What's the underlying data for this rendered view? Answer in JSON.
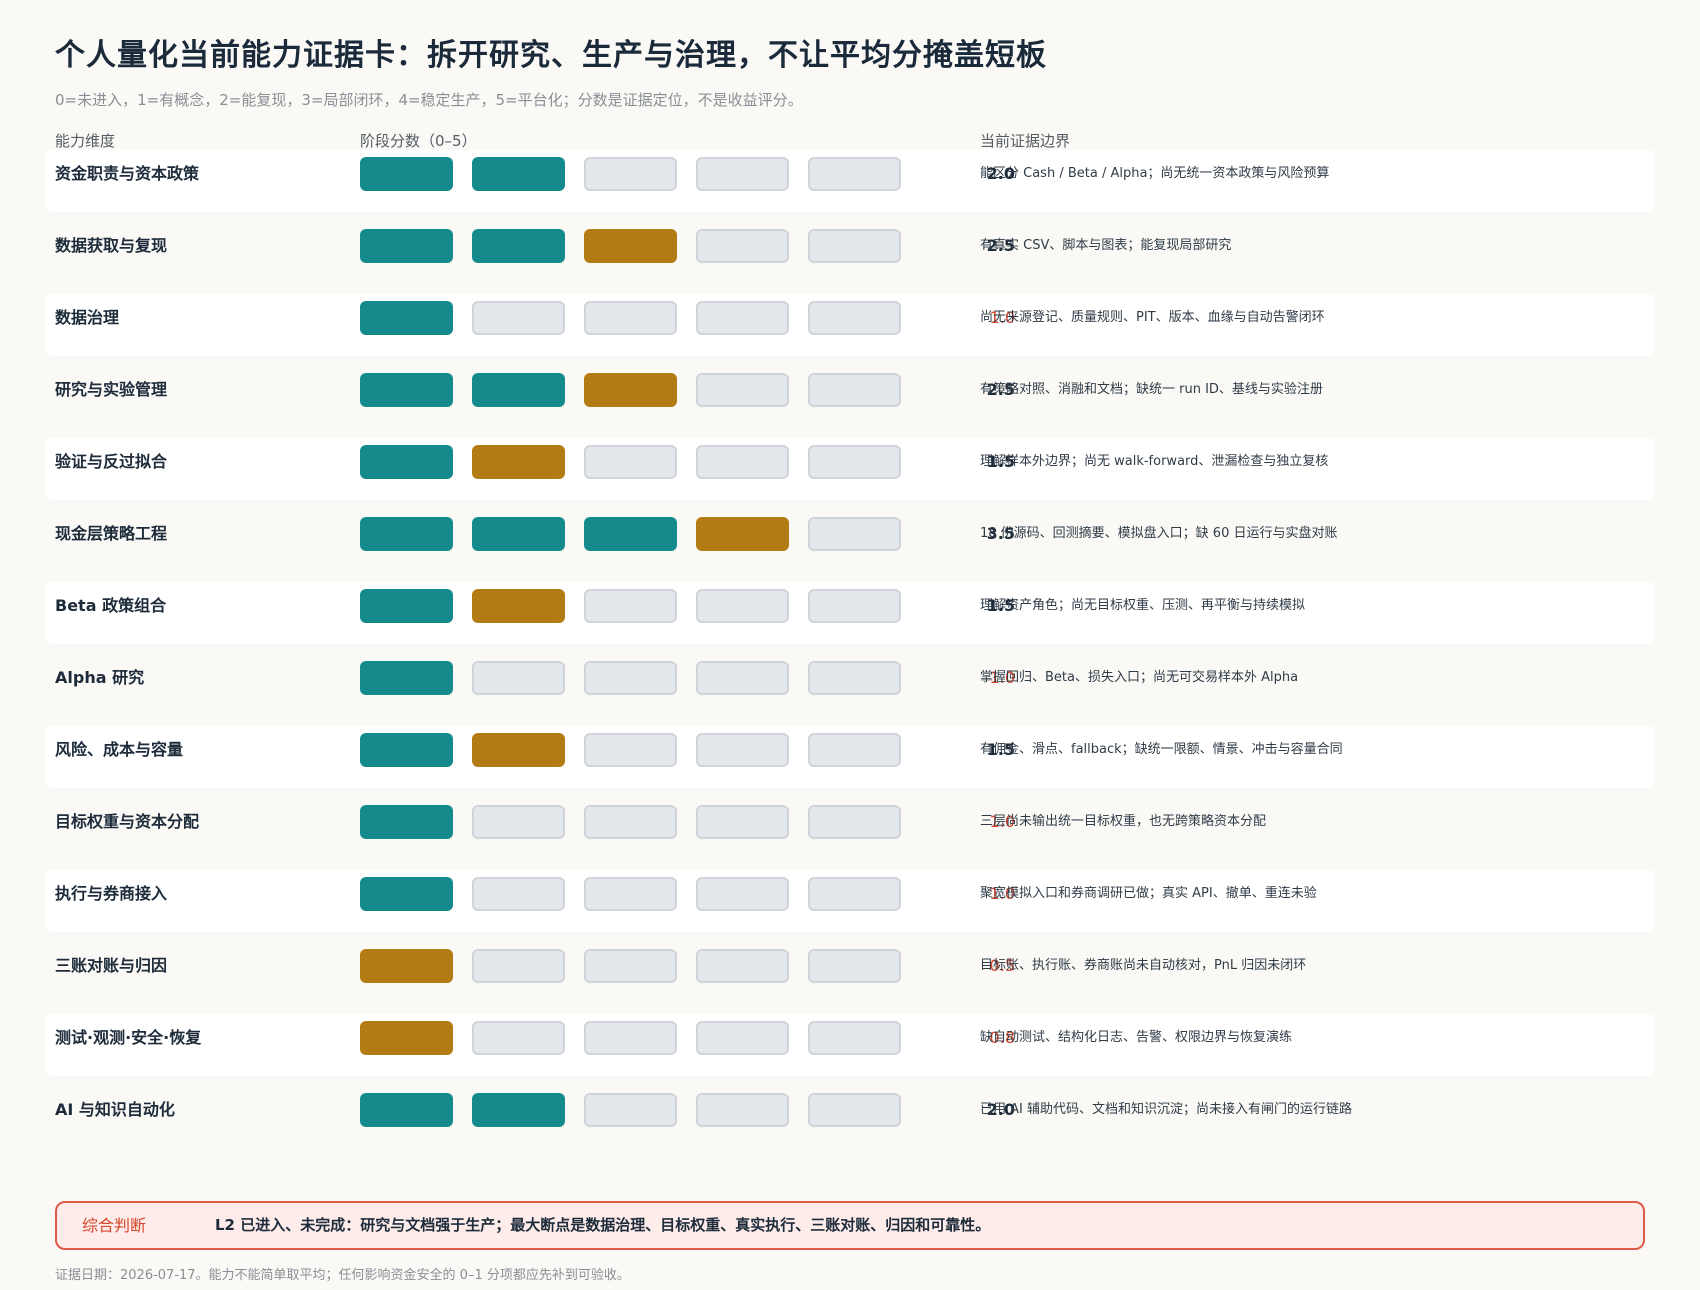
{
  "title": "个人量化当前能力证据卡：拆开研究、生产与治理，不让平均分掩盖短板",
  "subtitle": "0=未进入，1=有概念，2=能复现，3=局部闭环，4=稳定生产，5=平台化；分数是证据定位，不是收益评分。",
  "headers": {
    "dimension": "能力维度",
    "stage": "阶段分数（0–5）",
    "evidence": "当前证据边界"
  },
  "colors": {
    "full": "#148a8c",
    "partial": "#b37b13",
    "empty": "#e4e7eb",
    "weak_score": "#d6452c"
  },
  "chart_data": {
    "type": "bar",
    "xlim": [
      0,
      5
    ],
    "segments": 5,
    "rows": [
      {
        "dimension": "资金职责与资本政策",
        "score": 2.0,
        "score_label": "2.0",
        "evidence": "能区分 Cash / Beta / Alpha；尚无统一资本政策与风险预算"
      },
      {
        "dimension": "数据获取与复现",
        "score": 2.5,
        "score_label": "2.5",
        "evidence": "有真实 CSV、脚本与图表；能复现局部研究"
      },
      {
        "dimension": "数据治理",
        "score": 1.0,
        "score_label": "1.0",
        "evidence": "尚无来源登记、质量规则、PIT、版本、血缘与自动告警闭环"
      },
      {
        "dimension": "研究与实验管理",
        "score": 2.5,
        "score_label": "2.5",
        "evidence": "有策略对照、消融和文档；缺统一 run ID、基线与实验注册"
      },
      {
        "dimension": "验证与反过拟合",
        "score": 1.5,
        "score_label": "1.5",
        "evidence": "理解样本外边界；尚无 walk-forward、泄漏检查与独立复核"
      },
      {
        "dimension": "现金层策略工程",
        "score": 3.5,
        "score_label": "3.5",
        "evidence": "18 份源码、回测摘要、模拟盘入口；缺 60 日运行与实盘对账"
      },
      {
        "dimension": "Beta 政策组合",
        "score": 1.5,
        "score_label": "1.5",
        "evidence": "理解资产角色；尚无目标权重、压测、再平衡与持续模拟"
      },
      {
        "dimension": "Alpha 研究",
        "score": 1.0,
        "score_label": "1.0",
        "evidence": "掌握回归、Beta、损失入口；尚无可交易样本外 Alpha"
      },
      {
        "dimension": "风险、成本与容量",
        "score": 1.5,
        "score_label": "1.5",
        "evidence": "有佣金、滑点、fallback；缺统一限额、情景、冲击与容量合同"
      },
      {
        "dimension": "目标权重与资本分配",
        "score": 1.0,
        "score_label": "1.0",
        "evidence": "三层尚未输出统一目标权重，也无跨策略资本分配"
      },
      {
        "dimension": "执行与券商接入",
        "score": 1.0,
        "score_label": "1.0",
        "evidence": "聚宽模拟入口和券商调研已做；真实 API、撤单、重连未验"
      },
      {
        "dimension": "三账对账与归因",
        "score": 0.5,
        "score_label": "0.5",
        "evidence": "目标账、执行账、券商账尚未自动核对，PnL 归因未闭环"
      },
      {
        "dimension": "测试·观测·安全·恢复",
        "score": 0.8,
        "score_label": "0.8",
        "evidence": "缺自动测试、结构化日志、告警、权限边界与恢复演练"
      },
      {
        "dimension": "AI 与知识自动化",
        "score": 2.0,
        "score_label": "2.0",
        "evidence": "已用 AI 辅助代码、文档和知识沉淀；尚未接入有闸门的运行链路"
      }
    ]
  },
  "summary": {
    "label": "综合判断",
    "text": "L2 已进入、未完成：研究与文档强于生产；最大断点是数据治理、目标权重、真实执行、三账对账、归因和可靠性。"
  },
  "footer": "证据日期：2026-07-17。能力不能简单取平均；任何影响资金安全的 0–1 分项都应先补到可验收。"
}
